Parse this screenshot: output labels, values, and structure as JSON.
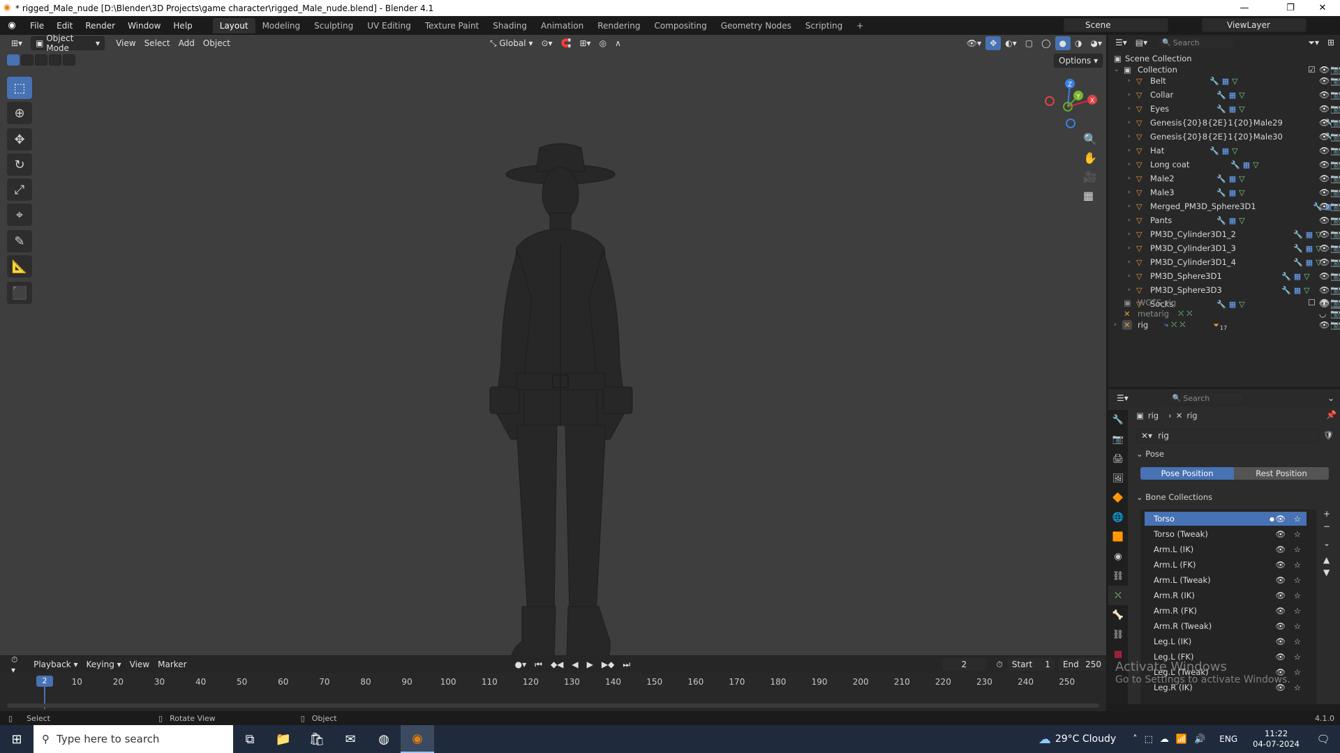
{
  "window": {
    "title": "* rigged_Male_nude [D:\\Blender\\3D Projects\\game character\\rigged_Male_nude.blend] - Blender 4.1",
    "minimize": "—",
    "maximize": "❐",
    "close": "✕"
  },
  "menu": {
    "items": [
      "File",
      "Edit",
      "Render",
      "Window",
      "Help"
    ],
    "workspaces": [
      "Layout",
      "Modeling",
      "Sculpting",
      "UV Editing",
      "Texture Paint",
      "Shading",
      "Animation",
      "Rendering",
      "Compositing",
      "Geometry Nodes",
      "Scripting"
    ],
    "add_tab": "+",
    "scene_label": "Scene",
    "viewlayer_label": "ViewLayer"
  },
  "viewport": {
    "mode": "Object Mode",
    "menus": [
      "View",
      "Select",
      "Add",
      "Object"
    ],
    "orientation": "Global",
    "options": "Options",
    "gizmo": {
      "z": "Z",
      "y": "Y",
      "x": "X"
    }
  },
  "outliner": {
    "search_placeholder": "Search",
    "scene_collection": "Scene Collection",
    "collection": "Collection",
    "objects": [
      "Belt",
      "Collar",
      "Eyes",
      "Genesis{20}8{2E}1{20}Male29",
      "Genesis{20}8{2E}1{20}Male30",
      "Hat",
      "Long coat",
      "Male2",
      "Male3",
      "Merged_PM3D_Sphere3D1",
      "Pants",
      "PM3D_Cylinder3D1_2",
      "PM3D_Cylinder3D1_3",
      "PM3D_Cylinder3D1_4",
      "PM3D_Sphere3D1",
      "PM3D_Sphere3D3",
      "Socks"
    ],
    "wgts": "WGTS_rig",
    "metarig": "metarig",
    "rig": "rig",
    "rig_badge": "17"
  },
  "properties": {
    "search_placeholder": "Search",
    "breadcrumb": [
      "rig",
      "rig"
    ],
    "datablock": "rig",
    "pose_header": "Pose",
    "pose_position": "Pose Position",
    "rest_position": "Rest Position",
    "bone_collections_header": "Bone Collections",
    "bone_collections": [
      "Torso",
      "Torso (Tweak)",
      "Arm.L (IK)",
      "Arm.L (FK)",
      "Arm.L (Tweak)",
      "Arm.R (IK)",
      "Arm.R (FK)",
      "Arm.R (Tweak)",
      "Leg.L (IK)",
      "Leg.L (FK)",
      "Leg.L (Tweak)",
      "Leg.R (IK)"
    ]
  },
  "timeline": {
    "menus": [
      "Playback",
      "Keying",
      "View",
      "Marker"
    ],
    "current_frame": "2",
    "start_label": "Start",
    "start": "1",
    "end_label": "End",
    "end": "250",
    "ticks": [
      "10",
      "20",
      "30",
      "40",
      "50",
      "60",
      "70",
      "80",
      "90",
      "100",
      "110",
      "120",
      "130",
      "140",
      "150",
      "160",
      "170",
      "180",
      "190",
      "200",
      "210",
      "220",
      "230",
      "240",
      "250"
    ],
    "playhead": "2"
  },
  "status": {
    "select": "Select",
    "rotate": "Rotate View",
    "object": "Object",
    "version": "4.1.0"
  },
  "watermark": {
    "line1": "Activate Windows",
    "line2": "Go to Settings to activate Windows."
  },
  "taskbar": {
    "search_placeholder": "Type here to search",
    "weather": "29°C  Cloudy",
    "lang": "ENG",
    "time": "11:22",
    "date": "04-07-2024"
  }
}
